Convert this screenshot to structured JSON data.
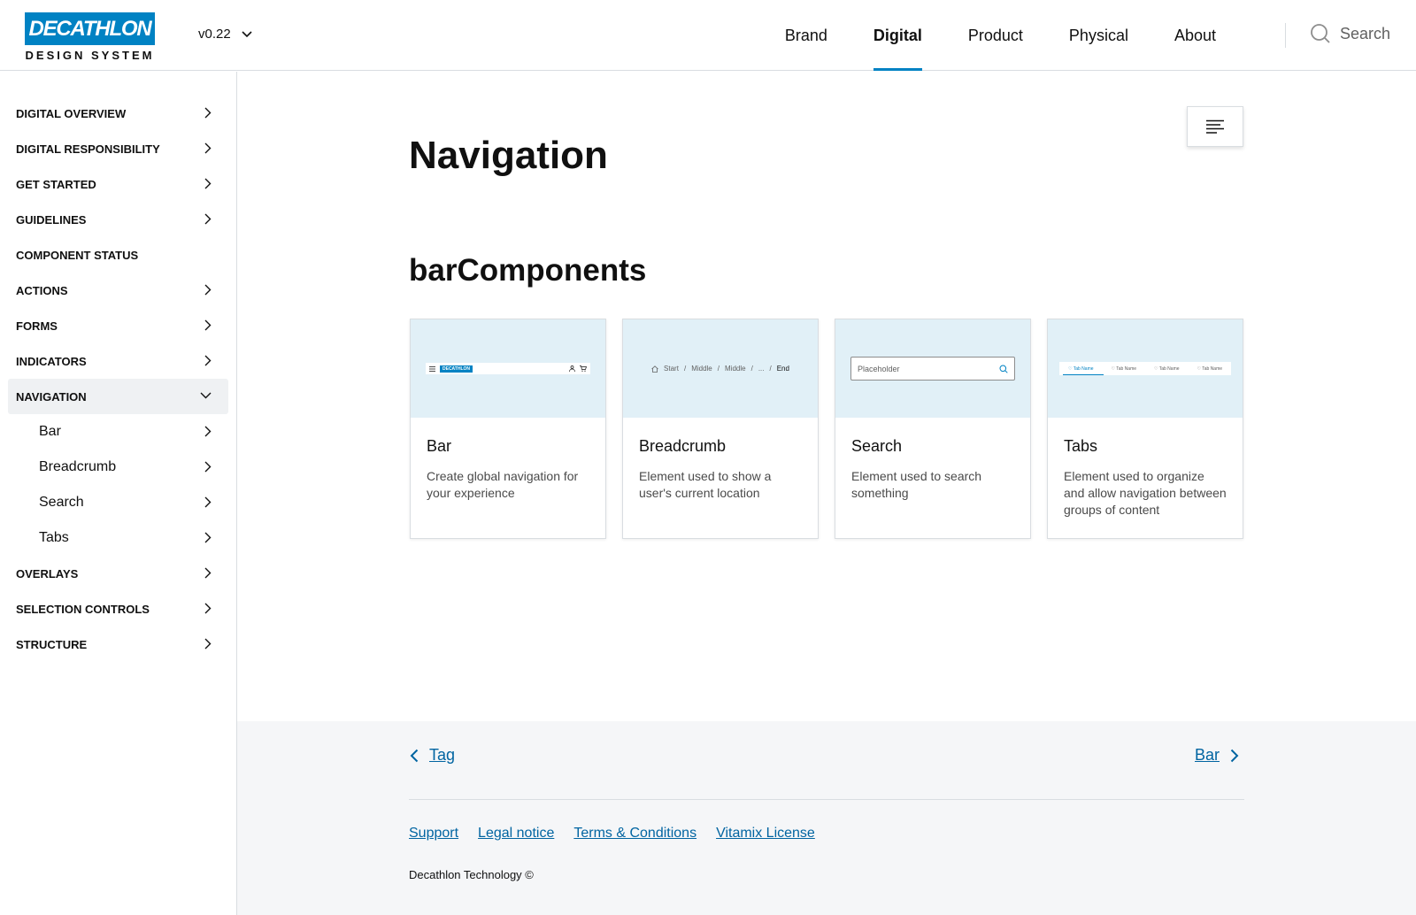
{
  "header": {
    "logo_text": "DECATHLON",
    "logo_sub": "DESIGN SYSTEM",
    "version": "v0.22",
    "nav": [
      "Brand",
      "Digital",
      "Product",
      "Physical",
      "About"
    ],
    "active_nav": "Digital",
    "search_label": "Search"
  },
  "sidebar": {
    "items": [
      {
        "label": "DIGITAL OVERVIEW"
      },
      {
        "label": "DIGITAL RESPONSIBILITY"
      },
      {
        "label": "GET STARTED"
      },
      {
        "label": "GUIDELINES"
      },
      {
        "label": "COMPONENT STATUS"
      },
      {
        "label": "ACTIONS"
      },
      {
        "label": "FORMS"
      },
      {
        "label": "INDICATORS"
      },
      {
        "label": "NAVIGATION",
        "expanded": true
      },
      {
        "label": "OVERLAYS"
      },
      {
        "label": "SELECTION CONTROLS"
      },
      {
        "label": "STRUCTURE"
      }
    ],
    "navigation_children": [
      "Bar",
      "Breadcrumb",
      "Search",
      "Tabs"
    ]
  },
  "main": {
    "title": "Navigation",
    "section_title": "barComponents",
    "cards": [
      {
        "name": "Bar",
        "description": "Create global navigation for your experience"
      },
      {
        "name": "Breadcrumb",
        "description": "Element used to show a user's current location"
      },
      {
        "name": "Search",
        "description": "Element used to search something"
      },
      {
        "name": "Tabs",
        "description": "Element used to organize and allow navigation between groups of content"
      }
    ],
    "thumbs": {
      "bar_logo": "DECATHLON",
      "crumbs": [
        "Start",
        "/",
        "Middle",
        "/",
        "Middle",
        "/",
        "...",
        "/"
      ],
      "crumb_end": "End",
      "search_placeholder": "Placeholder",
      "tabs": [
        "Tab Name",
        "Tab Name",
        "Tab Name",
        "Tab Name"
      ]
    }
  },
  "footer": {
    "prev_label": "Tag",
    "next_label": "Bar",
    "links": [
      "Support",
      "Legal notice",
      "Terms & Conditions",
      "Vitamix License"
    ],
    "copyright": "Decathlon Technology ©"
  },
  "colors": {
    "brand": "#0082c3",
    "link": "#0064a1",
    "thumb_bg": "#e1f0f7"
  }
}
